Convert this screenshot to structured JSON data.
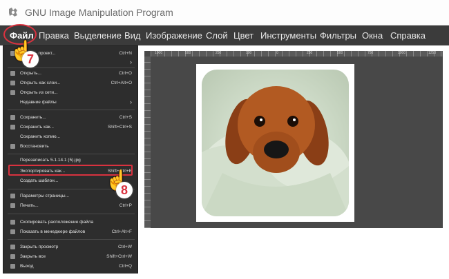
{
  "window": {
    "title": "GNU Image Manipulation Program"
  },
  "menubar": [
    "Файл",
    "Правка",
    "Выделение",
    "Вид",
    "Изображение",
    "Слой",
    "Цвет",
    "Инструменты",
    "Фильтры",
    "Окна",
    "Справка"
  ],
  "menu": {
    "items": [
      {
        "label": "Создать проект...",
        "shortcut": "Ctrl+N"
      },
      {
        "label": "",
        "shortcut": "",
        "submenu": true
      },
      {
        "label": "Открыть...",
        "shortcut": "Ctrl+O"
      },
      {
        "label": "Открыть как слои...",
        "shortcut": "Ctrl+Alt+O"
      },
      {
        "label": "Открыть из сети...",
        "shortcut": ""
      },
      {
        "label": "Недавние файлы",
        "shortcut": "",
        "submenu": true
      },
      {
        "label": "Сохранить...",
        "shortcut": "Ctrl+S"
      },
      {
        "label": "Сохранить как...",
        "shortcut": "Shift+Ctrl+S"
      },
      {
        "label": "Сохранить копию...",
        "shortcut": ""
      },
      {
        "label": "Восстановить",
        "shortcut": ""
      },
      {
        "label": "Перезаписать 5.1.14.1 (5).jpg",
        "shortcut": ""
      },
      {
        "label": "Экспортировать как...",
        "shortcut": "Shift+Ctrl+E"
      },
      {
        "label": "Создать шаблон...",
        "shortcut": ""
      },
      {
        "label": "Параметры страницы...",
        "shortcut": ""
      },
      {
        "label": "Печать...",
        "shortcut": "Ctrl+P"
      },
      {
        "label": "Скопировать расположение файла",
        "shortcut": ""
      },
      {
        "label": "Показать в менеджере файлов",
        "shortcut": "Ctrl+Alt+F"
      },
      {
        "label": "Закрыть просмотр",
        "shortcut": "Ctrl+W"
      },
      {
        "label": "Закрыть все",
        "shortcut": "Shift+Ctrl+W"
      },
      {
        "label": "Выход",
        "shortcut": "Ctrl+Q"
      }
    ]
  },
  "annotations": {
    "step1": "7",
    "step2": "8"
  },
  "colors": {
    "accent": "#d9323f",
    "menubar": "#3b3b3b",
    "menu": "#2d2d2d",
    "canvas": "#484848"
  },
  "ruler": {
    "marks": [
      "1000",
      "500",
      "250",
      "100",
      "0",
      "250",
      "500",
      "750",
      "1000",
      "1250"
    ]
  }
}
